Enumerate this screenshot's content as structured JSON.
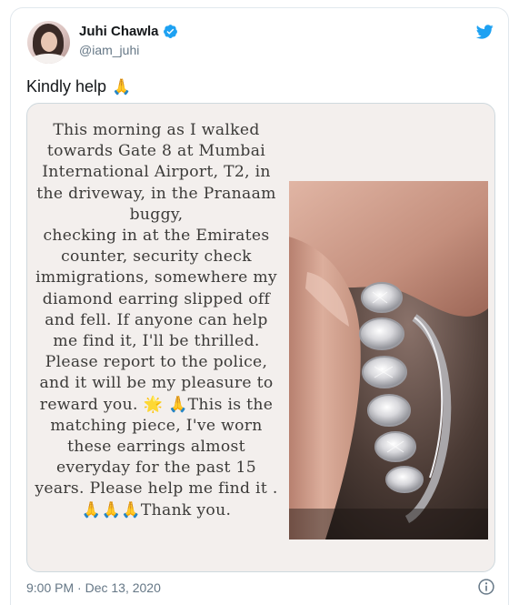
{
  "user": {
    "name": "Juhi Chawla",
    "handle": "@iam_juhi"
  },
  "tweet": {
    "text": "Kindly help",
    "emoji": "folded-hands",
    "timestamp": "9:00 PM · Dec 13, 2020"
  },
  "note": {
    "text": "This morning as I walked\ntowards Gate 8 at Mumbai\nInternational Airport, T2, in\nthe driveway, in the Pranaam\nbuggy,\nchecking in at the Emirates\ncounter, security check\nimmigrations, somewhere my\ndiamond earring slipped off\nand fell. If anyone can  help\nme find it, I'll be thrilled.\nPlease report to the police,\nand it will be my pleasure to\nreward you. 🌟 🙏This is the\nmatching piece, I've worn\nthese earrings almost\neveryday for the past 15\nyears. Please help me find it .\n🙏🙏🙏Thank you."
  },
  "colors": {
    "twitter_blue": "#1da1f2",
    "text_primary": "#14171a",
    "text_secondary": "#657786",
    "border": "#e1e8ed"
  }
}
